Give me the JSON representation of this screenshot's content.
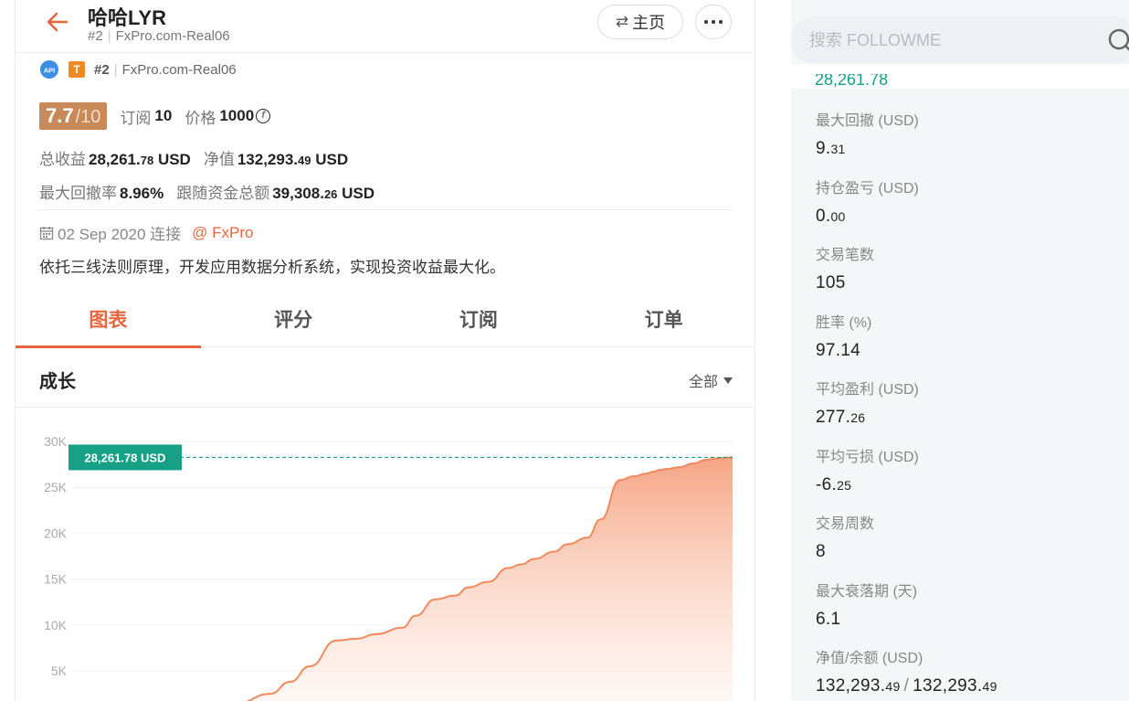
{
  "header": {
    "title": "哈哈LYR",
    "rank": "#2",
    "account": "FxPro.com-Real06",
    "home_label": "主页"
  },
  "meta": {
    "api_badge": "API",
    "t_badge": "T",
    "rank": "#2",
    "account": "FxPro.com-Real06"
  },
  "score": {
    "value": "7.7",
    "total": "/10",
    "subscribe_label": "订阅",
    "subscribe_value": "10",
    "price_label": "价格",
    "price_value": "1000",
    "coin_symbol": "f"
  },
  "stats_main": {
    "total_profit_label": "总收益",
    "total_profit_int": "28,261.",
    "total_profit_dec": "78",
    "total_profit_unit": "USD",
    "equity_label": "净值",
    "equity_int": "132,293.",
    "equity_dec": "49",
    "equity_unit": "USD",
    "max_drawdown_label": "最大回撤率",
    "max_drawdown_value": "8.96%",
    "follow_funds_label": "跟随资金总额",
    "follow_funds_int": "39,308.",
    "follow_funds_dec": "26",
    "follow_funds_unit": "USD"
  },
  "connect": {
    "date": "02 Sep 2020 连接",
    "broker": "@ FxPro"
  },
  "description": "依托三线法则原理，开发应用数据分析系统，实现投资收益最大化。",
  "tabs": [
    {
      "label": "图表",
      "active": true
    },
    {
      "label": "评分",
      "active": false
    },
    {
      "label": "订阅",
      "active": false
    },
    {
      "label": "订单",
      "active": false
    }
  ],
  "growth": {
    "title": "成长",
    "range_label": "全部"
  },
  "chart_data": {
    "type": "area",
    "y_ticks": [
      "30K",
      "25K",
      "20K",
      "15K",
      "10K",
      "5K"
    ],
    "y_tick_values": [
      30000,
      25000,
      20000,
      15000,
      10000,
      5000
    ],
    "ylim": [
      0,
      30000
    ],
    "current_label": "28,261.78 USD",
    "current_value": 28261.78,
    "x": [
      0,
      0.05,
      0.1,
      0.15,
      0.2,
      0.25,
      0.3,
      0.33,
      0.36,
      0.4,
      0.43,
      0.46,
      0.5,
      0.52,
      0.55,
      0.58,
      0.6,
      0.63,
      0.66,
      0.68,
      0.7,
      0.73,
      0.75,
      0.78,
      0.8,
      0.83,
      0.85,
      0.87,
      0.88,
      0.89,
      0.9,
      0.92,
      0.94,
      0.96,
      0.97,
      0.98,
      1.0
    ],
    "values": [
      0,
      0,
      0,
      0,
      0,
      1500,
      2500,
      3800,
      5500,
      8300,
      8500,
      9000,
      9700,
      11000,
      12800,
      13200,
      14100,
      14700,
      16200,
      16600,
      17200,
      18000,
      18800,
      19500,
      21500,
      25800,
      26200,
      26500,
      26700,
      26900,
      27000,
      27200,
      27600,
      28000,
      28100,
      28200,
      28261.78
    ],
    "line_color": "#f08a5d",
    "fill_top": "#f5a07e",
    "fill_bottom": "#fdebe2",
    "label_bg": "#16a085",
    "dash_color": "#16a085"
  },
  "search": {
    "placeholder": "搜索 FOLLOWME"
  },
  "right_partial_value": "28,261.78",
  "right_stats": [
    {
      "label": "最大回撤 (USD)",
      "int": "9.",
      "dec": "31"
    },
    {
      "label": "持仓盈亏 (USD)",
      "int": "0.",
      "dec": "00"
    },
    {
      "label": "交易笔数",
      "int": "105",
      "dec": ""
    },
    {
      "label": "胜率 (%)",
      "int": "97.14",
      "dec": ""
    },
    {
      "label": "平均盈利 (USD)",
      "int": "277.",
      "dec": "26"
    },
    {
      "label": "平均亏损 (USD)",
      "int": "-6.",
      "dec": "25"
    },
    {
      "label": "交易周数",
      "int": "8",
      "dec": ""
    },
    {
      "label": "最大衰落期 (天)",
      "int": "6.1",
      "dec": ""
    }
  ],
  "right_equity": {
    "label": "净值/余额 (USD)",
    "equity_int": "132,293.",
    "equity_dec": "49",
    "balance_int": "132,293.",
    "balance_dec": "49"
  },
  "colors": {
    "accent": "#e8663d",
    "score_bg": "#c98a5a",
    "teal": "#16a085"
  }
}
